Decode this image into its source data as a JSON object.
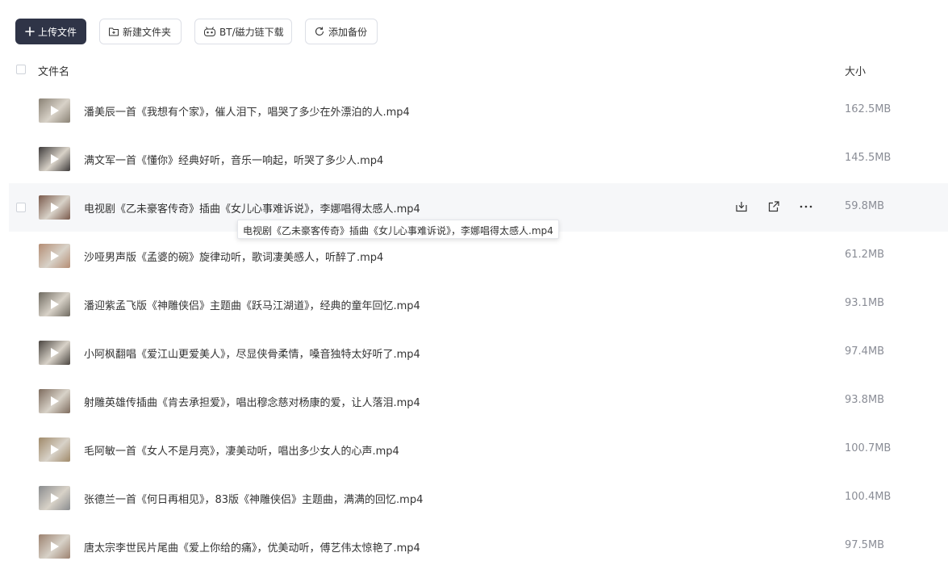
{
  "toolbar": {
    "upload_label": "上传文件",
    "new_folder_label": "新建文件夹",
    "bt_label": "BT/磁力链下载",
    "backup_label": "添加备份"
  },
  "header": {
    "name_label": "文件名",
    "size_label": "大小"
  },
  "files": [
    {
      "name": "潘美辰一首《我想有个家》，催人泪下，唱哭了多少在外漂泊的人.mp4",
      "size": "162.5MB",
      "thumb_color": "#8a8275"
    },
    {
      "name": "满文军一首《懂你》经典好听，音乐一响起，听哭了多少人.mp4",
      "size": "145.5MB",
      "thumb_color": "#3d3a3a"
    },
    {
      "name": "电视剧《乙未豪客传奇》插曲《女儿心事难诉说》，李娜唱得太感人.mp4",
      "size": "59.8MB",
      "thumb_color": "#7a5a4c"
    },
    {
      "name": "沙哑男声版《孟婆的碗》旋律动听，歌词凄美感人，听醉了.mp4",
      "size": "61.2MB",
      "thumb_color": "#b48d74"
    },
    {
      "name": "潘迎紫孟飞版《神雕侠侣》主题曲《跃马江湖道》，经典的童年回忆.mp4",
      "size": "93.1MB",
      "thumb_color": "#6f6a60"
    },
    {
      "name": "小阿枫翻唱《爱江山更爱美人》，尽显侠骨柔情，嗓音独特太好听了.mp4",
      "size": "97.4MB",
      "thumb_color": "#4a4540"
    },
    {
      "name": "射雕英雄传插曲《肯去承担爱》，唱出穆念慈对杨康的爱，让人落泪.mp4",
      "size": "93.8MB",
      "thumb_color": "#7d6b5d"
    },
    {
      "name": "毛阿敏一首《女人不是月亮》，凄美动听，唱出多少女人的心声.mp4",
      "size": "100.7MB",
      "thumb_color": "#a08a6a"
    },
    {
      "name": "张德兰一首《何日再相见》，83版《神雕侠侣》主题曲，满满的回忆.mp4",
      "size": "100.4MB",
      "thumb_color": "#8a8c8e"
    },
    {
      "name": "唐太宗李世民片尾曲《爱上你给的痛》，优美动听，傅艺伟太惊艳了.mp4",
      "size": "97.5MB",
      "thumb_color": "#9c8270"
    }
  ],
  "tooltip": {
    "text": "电视剧《乙未豪客传奇》插曲《女儿心事难诉说》，李娜唱得太感人.mp4"
  },
  "icons": {
    "plus": "plus-icon",
    "folder_add": "folder-add-icon",
    "bt": "bt-icon",
    "backup": "backup-icon",
    "download": "download-icon",
    "share": "share-icon",
    "more": "more-icon"
  }
}
